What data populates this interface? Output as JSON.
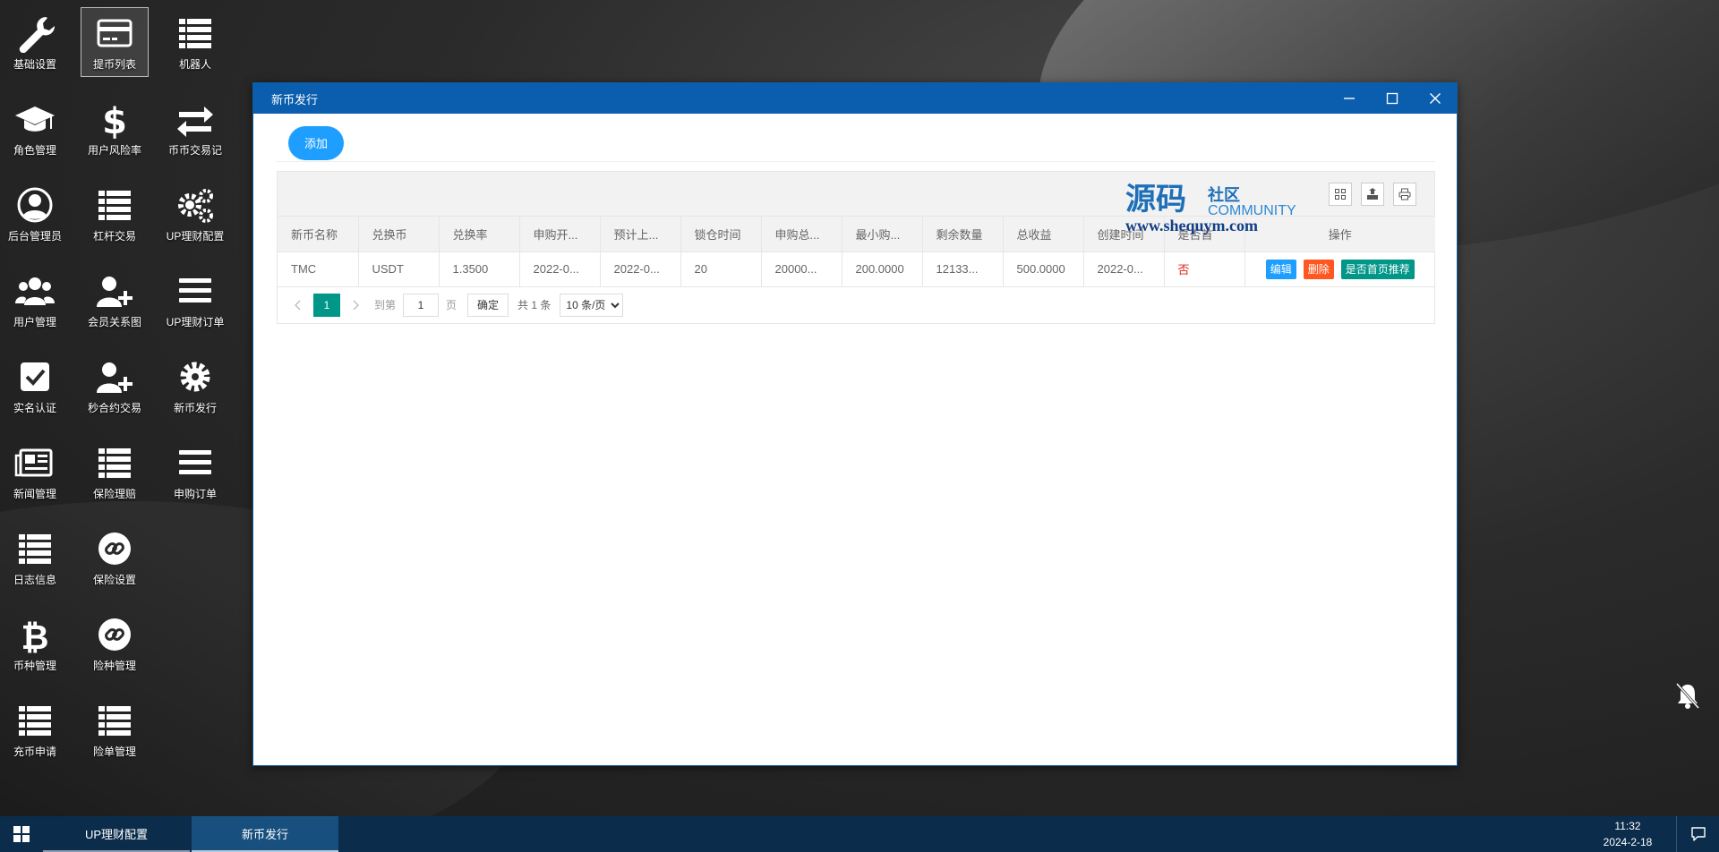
{
  "desktop": {
    "icons": [
      {
        "label": "基础设置",
        "icon": "wrench-icon"
      },
      {
        "label": "提币列表",
        "icon": "card-icon",
        "selected": true
      },
      {
        "label": "机器人",
        "icon": "list-icon"
      },
      {
        "label": "角色管理",
        "icon": "graduation-cap-icon"
      },
      {
        "label": "用户风险率",
        "icon": "dollar-icon"
      },
      {
        "label": "币币交易记",
        "icon": "exchange-icon"
      },
      {
        "label": "后台管理员",
        "icon": "user-circle-icon"
      },
      {
        "label": "杠杆交易",
        "icon": "list-icon"
      },
      {
        "label": "UP理财配置",
        "icon": "gears-icon"
      },
      {
        "label": "用户管理",
        "icon": "users-icon"
      },
      {
        "label": "会员关系图",
        "icon": "user-plus-icon"
      },
      {
        "label": "UP理财订单",
        "icon": "bars-icon"
      },
      {
        "label": "实名认证",
        "icon": "check-square-icon"
      },
      {
        "label": "秒合约交易",
        "icon": "user-plus-icon"
      },
      {
        "label": "新币发行",
        "icon": "gear-icon"
      },
      {
        "label": "新闻管理",
        "icon": "newspaper-icon"
      },
      {
        "label": "保险理赔",
        "icon": "list-icon"
      },
      {
        "label": "申购订单",
        "icon": "bars-icon"
      },
      {
        "label": "日志信息",
        "icon": "list-icon"
      },
      {
        "label": "保险设置",
        "icon": "link-circle-icon"
      },
      {
        "label": "币种管理",
        "icon": "bitcoin-icon"
      },
      {
        "label": "险种管理",
        "icon": "link-circle-icon"
      },
      {
        "label": "充币申请",
        "icon": "list-icon"
      },
      {
        "label": "险单管理",
        "icon": "list-icon"
      }
    ]
  },
  "window": {
    "title": "新币发行",
    "add_label": "添加",
    "watermark": {
      "cn": "源码",
      "cn2": "社区",
      "en": "COMMUNITY",
      "url": "www.shequym.com"
    },
    "table": {
      "columns": [
        "新币名称",
        "兑换币",
        "兑换率",
        "申购开...",
        "预计上...",
        "锁仓时间",
        "申购总...",
        "最小购...",
        "剩余数量",
        "总收益",
        "创建时间",
        "是否首",
        "操作"
      ],
      "rows": [
        {
          "cells": [
            "TMC",
            "USDT",
            "1.3500",
            "2022-0...",
            "2022-0...",
            "20",
            "20000...",
            "200.0000",
            "12133...",
            "500.0000",
            "2022-0..."
          ],
          "flag": "否",
          "actions": {
            "edit": "编辑",
            "delete": "删除",
            "recommend": "是否首页推荐"
          }
        }
      ]
    },
    "pager": {
      "current": "1",
      "goto_prefix": "到第",
      "goto_value": "1",
      "goto_suffix": "页",
      "confirm": "确定",
      "total": "共 1 条",
      "page_size": "10 条/页"
    }
  },
  "taskbar": {
    "items": [
      {
        "label": "UP理财配置",
        "active": false
      },
      {
        "label": "新币发行",
        "active": true
      }
    ],
    "time": "11:32",
    "date": "2024-2-18"
  },
  "colors": {
    "titlebar": "#0b5eae",
    "primary": "#1e9fff",
    "danger": "#ff5722",
    "teal": "#009688",
    "taskbar": "#0b2c4b"
  }
}
